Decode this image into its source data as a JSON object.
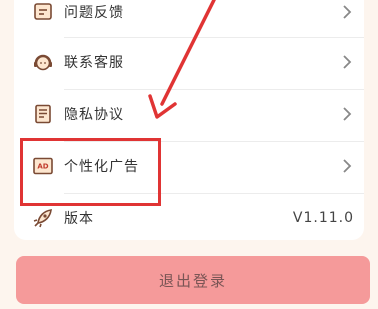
{
  "settings": {
    "items": [
      {
        "label": "问题反馈",
        "icon": "feedback-icon"
      },
      {
        "label": "联系客服",
        "icon": "customer-service-icon"
      },
      {
        "label": "隐私协议",
        "icon": "privacy-icon"
      },
      {
        "label": "个性化广告",
        "icon": "ad-icon",
        "icon_text": "AD"
      },
      {
        "label": "版本",
        "icon": "rocket-icon",
        "value": "V1.11.0"
      }
    ]
  },
  "logout": {
    "label": "退出登录"
  },
  "colors": {
    "background": "#fdf5ee",
    "icon_line": "#7a4a34",
    "highlight": "#e03434",
    "logout_button": "#f59a9a",
    "logout_text": "#7a5555"
  }
}
